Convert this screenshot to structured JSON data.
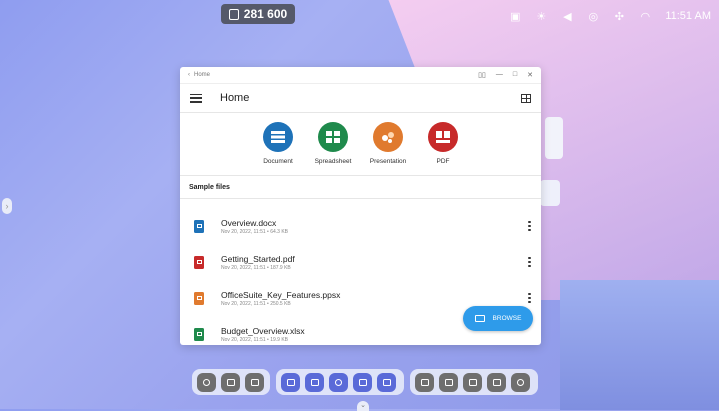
{
  "counter": {
    "value": "281 600"
  },
  "status": {
    "time": "11:51 AM"
  },
  "window": {
    "titlebar_title": "Home",
    "appbar_title": "Home",
    "categories": [
      {
        "label": "Document",
        "color": "#1e72b8"
      },
      {
        "label": "Spreadsheet",
        "color": "#1f8a4c"
      },
      {
        "label": "Presentation",
        "color": "#e07a2e"
      },
      {
        "label": "PDF",
        "color": "#c72a2a"
      }
    ],
    "section_title": "Sample files",
    "files": [
      {
        "name": "Overview.docx",
        "meta": "Nov 20, 2022, 11:51 • 64.3 KB",
        "color": "#1e72b8"
      },
      {
        "name": "Getting_Started.pdf",
        "meta": "Nov 20, 2022, 11:51 • 187.9 KB",
        "color": "#c72a2a"
      },
      {
        "name": "OfficeSuite_Key_Features.ppsx",
        "meta": "Nov 20, 2022, 11:51 • 250.5 KB",
        "color": "#e07a2e"
      },
      {
        "name": "Budget_Overview.xlsx",
        "meta": "Nov 20, 2022, 11:51 • 19.9 KB",
        "color": "#1f8a4c"
      }
    ],
    "browse_label": "BROWSE"
  }
}
